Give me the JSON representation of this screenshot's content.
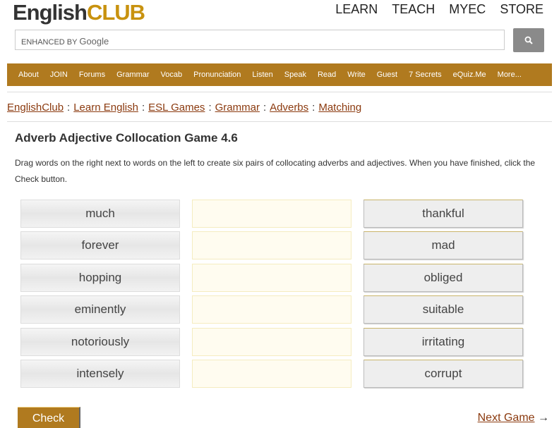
{
  "logo": {
    "part1": "English",
    "part2": "CLUB"
  },
  "topnav": [
    "LEARN",
    "TEACH",
    "MYEC",
    "STORE"
  ],
  "search": {
    "placeholder_prefix": "ENHANCED BY",
    "placeholder_brand": "Google",
    "button_icon": "search-icon"
  },
  "nav": [
    "About",
    "JOIN",
    "Forums",
    "Grammar",
    "Vocab",
    "Pronunciation",
    "Listen",
    "Speak",
    "Read",
    "Write",
    "Guest",
    "7 Secrets",
    "eQuiz.Me",
    "More..."
  ],
  "breadcrumb": [
    "EnglishClub",
    "Learn English",
    "ESL Games",
    "Grammar",
    "Adverbs",
    "Matching"
  ],
  "breadcrumb_sep": ":",
  "title": "Adverb Adjective Collocation Game 4.6",
  "instructions": "Drag words on the right next to words on the left to create six pairs of collocating adverbs and adjectives. When you have finished, click the Check button.",
  "left_words": [
    "much",
    "forever",
    "hopping",
    "eminently",
    "notoriously",
    "intensely"
  ],
  "right_words": [
    "thankful",
    "mad",
    "obliged",
    "suitable",
    "irritating",
    "corrupt"
  ],
  "check_label": "Check",
  "next_label": "Next Game",
  "next_arrow": "→"
}
